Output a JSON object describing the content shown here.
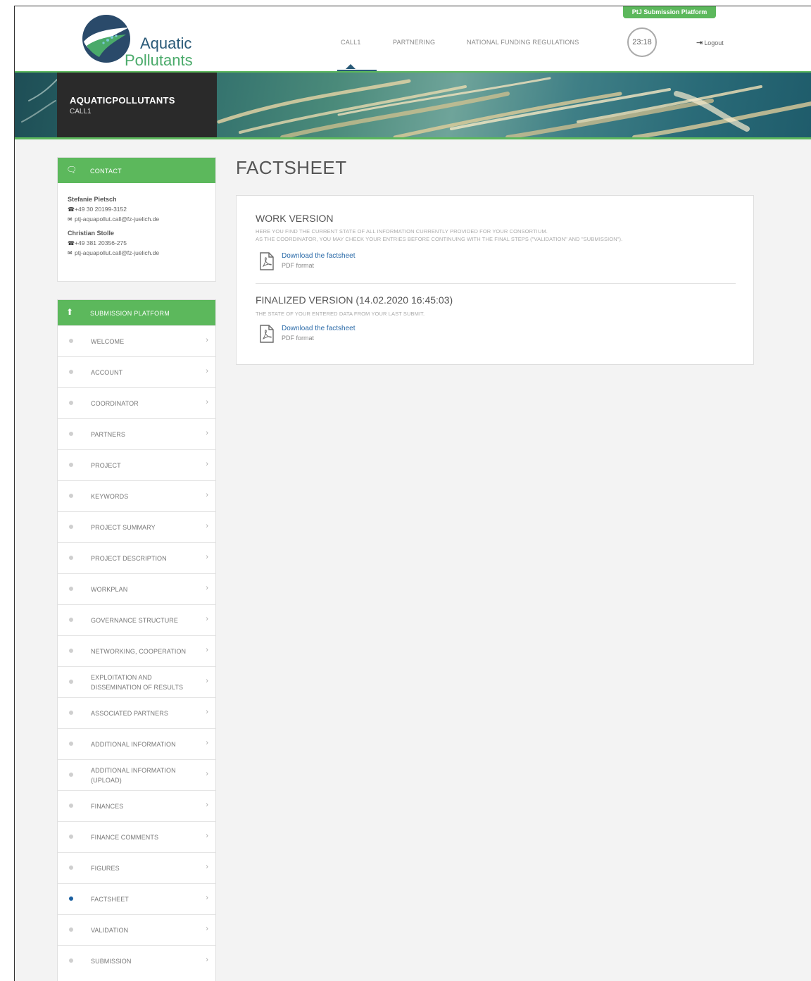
{
  "header": {
    "logo": {
      "line1": "Aquatic",
      "line2": "Pollutants"
    },
    "platform_tab": "PtJ Submission Platform",
    "nav": [
      {
        "label": "CALL1",
        "active": true
      },
      {
        "label": "PARTNERING",
        "active": false
      },
      {
        "label": "NATIONAL FUNDING REGULATIONS",
        "active": false
      }
    ],
    "timer": "23:18",
    "logout": "Logout"
  },
  "banner": {
    "title": "AQUATICPOLLUTANTS",
    "subtitle": "CALL1"
  },
  "contact": {
    "title": "CONTACT",
    "persons": [
      {
        "name": "Stefanie Pietsch",
        "phone": "+49 30 20199-3152",
        "email": "ptj-aquapollut.call@fz-juelich.de"
      },
      {
        "name": "Christian Stolle",
        "phone": "+49 381 20356-275",
        "email": "ptj-aquapollut.call@fz-juelich.de"
      }
    ]
  },
  "submission": {
    "title": "SUBMISSION PLATFORM",
    "items": [
      {
        "label": "WELCOME",
        "active": false
      },
      {
        "label": "ACCOUNT",
        "active": false
      },
      {
        "label": "COORDINATOR",
        "active": false
      },
      {
        "label": "PARTNERS",
        "active": false
      },
      {
        "label": "PROJECT",
        "active": false
      },
      {
        "label": "KEYWORDS",
        "active": false
      },
      {
        "label": "PROJECT SUMMARY",
        "active": false
      },
      {
        "label": "PROJECT DESCRIPTION",
        "active": false
      },
      {
        "label": "WORKPLAN",
        "active": false
      },
      {
        "label": "GOVERNANCE STRUCTURE",
        "active": false
      },
      {
        "label": "NETWORKING, COOPERATION",
        "active": false
      },
      {
        "label": "EXPLOITATION AND DISSEMINATION OF RESULTS",
        "active": false
      },
      {
        "label": "ASSOCIATED PARTNERS",
        "active": false
      },
      {
        "label": "ADDITIONAL INFORMATION",
        "active": false
      },
      {
        "label": "ADDITIONAL INFORMATION (UPLOAD)",
        "active": false
      },
      {
        "label": "FINANCES",
        "active": false
      },
      {
        "label": "FINANCE COMMENTS",
        "active": false
      },
      {
        "label": "FIGURES",
        "active": false
      },
      {
        "label": "FACTSHEET",
        "active": true
      },
      {
        "label": "VALIDATION",
        "active": false
      },
      {
        "label": "SUBMISSION",
        "active": false
      }
    ]
  },
  "main": {
    "title": "FACTSHEET",
    "work": {
      "title": "WORK VERSION",
      "desc1": "HERE YOU FIND THE CURRENT STATE OF ALL INFORMATION CURRENTLY PROVIDED FOR YOUR CONSORTIUM.",
      "desc2": "AS THE COORDINATOR, YOU MAY CHECK YOUR ENTRIES BEFORE CONTINUING WITH THE FINAL STEPS (\"VALIDATION\" AND \"SUBMISSION\").",
      "link": "Download the factsheet",
      "format": "PDF format"
    },
    "final": {
      "title": "FINALIZED VERSION (14.02.2020 16:45:03)",
      "desc1": "THE STATE OF YOUR ENTERED DATA FROM YOUR LAST SUBMIT.",
      "link": "Download the factsheet",
      "format": "PDF format"
    }
  },
  "colors": {
    "green": "#5cb85c",
    "navy": "#2a5a78",
    "link": "#2a6aa8",
    "active_dot": "#1a5fa0"
  }
}
